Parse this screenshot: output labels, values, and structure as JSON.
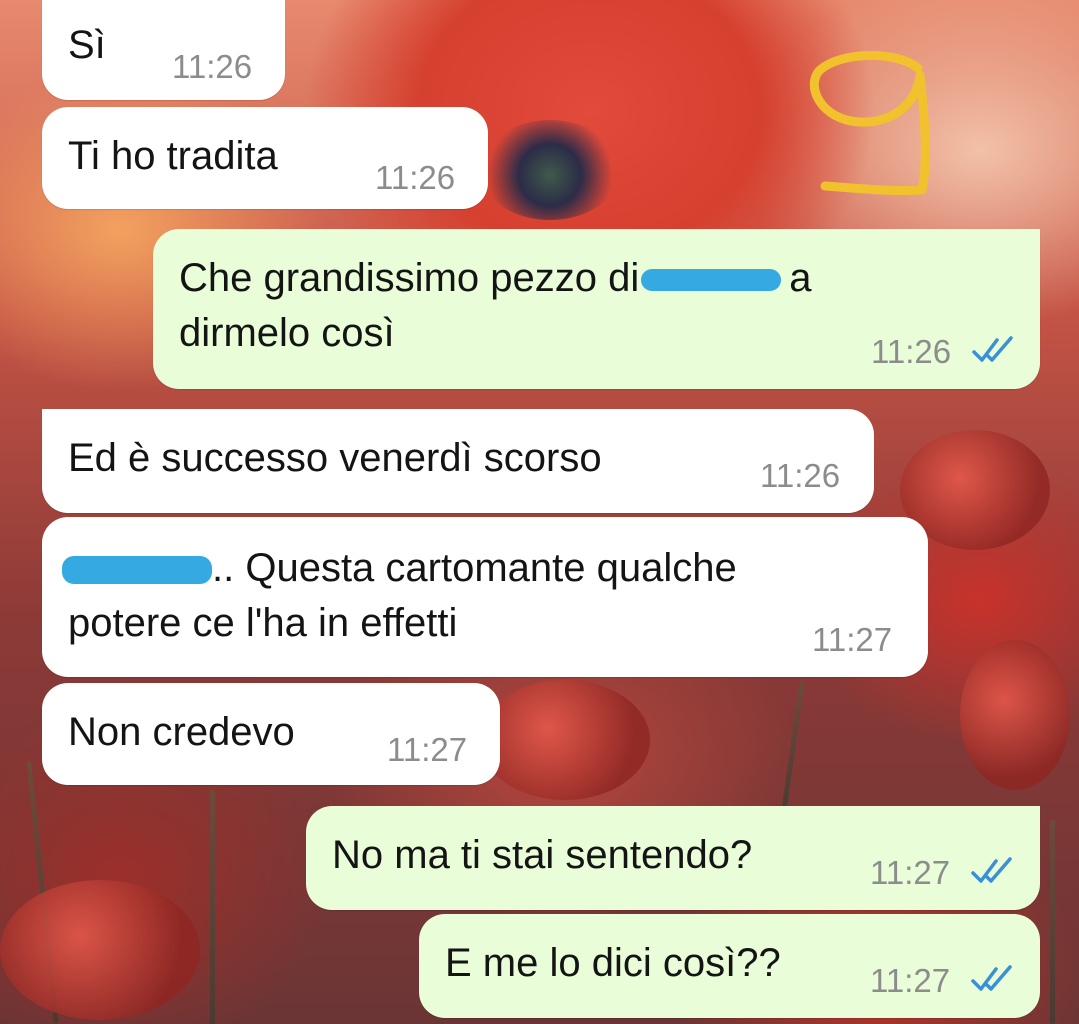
{
  "messages": [
    {
      "id": "m1",
      "dir": "incoming",
      "text": "Sì",
      "time": "11:26"
    },
    {
      "id": "m2",
      "dir": "incoming",
      "text": "Ti ho tradita",
      "time": "11:26"
    },
    {
      "id": "m3",
      "dir": "outgoing",
      "line1_a": "Che grandissimo pezzo di",
      "line1_b": "a",
      "line2": "dirmelo così",
      "time": "11:26",
      "status": "read"
    },
    {
      "id": "m4",
      "dir": "incoming",
      "text": "Ed è successo venerdì scorso",
      "time": "11:26"
    },
    {
      "id": "m5",
      "dir": "incoming",
      "line1_b": ".. Questa cartomante qualche",
      "line2": "potere ce l'ha in effetti",
      "time": "11:27"
    },
    {
      "id": "m6",
      "dir": "incoming",
      "text": "Non credevo",
      "time": "11:27"
    },
    {
      "id": "m7",
      "dir": "outgoing",
      "text": "No ma ti stai sentendo?",
      "time": "11:27",
      "status": "read"
    },
    {
      "id": "m8",
      "dir": "outgoing",
      "text": "E me lo dici così??",
      "time": "11:27",
      "status": "read"
    }
  ],
  "colors": {
    "incoming_bubble": "#ffffff",
    "outgoing_bubble": "#e8fdd8",
    "read_ticks": "#3b8fd6",
    "redaction": "#35a9e1",
    "doodle": "#f2c12e"
  },
  "icons": {
    "read_receipt": "double-check-icon",
    "doodle": "handwritten-9-icon"
  }
}
